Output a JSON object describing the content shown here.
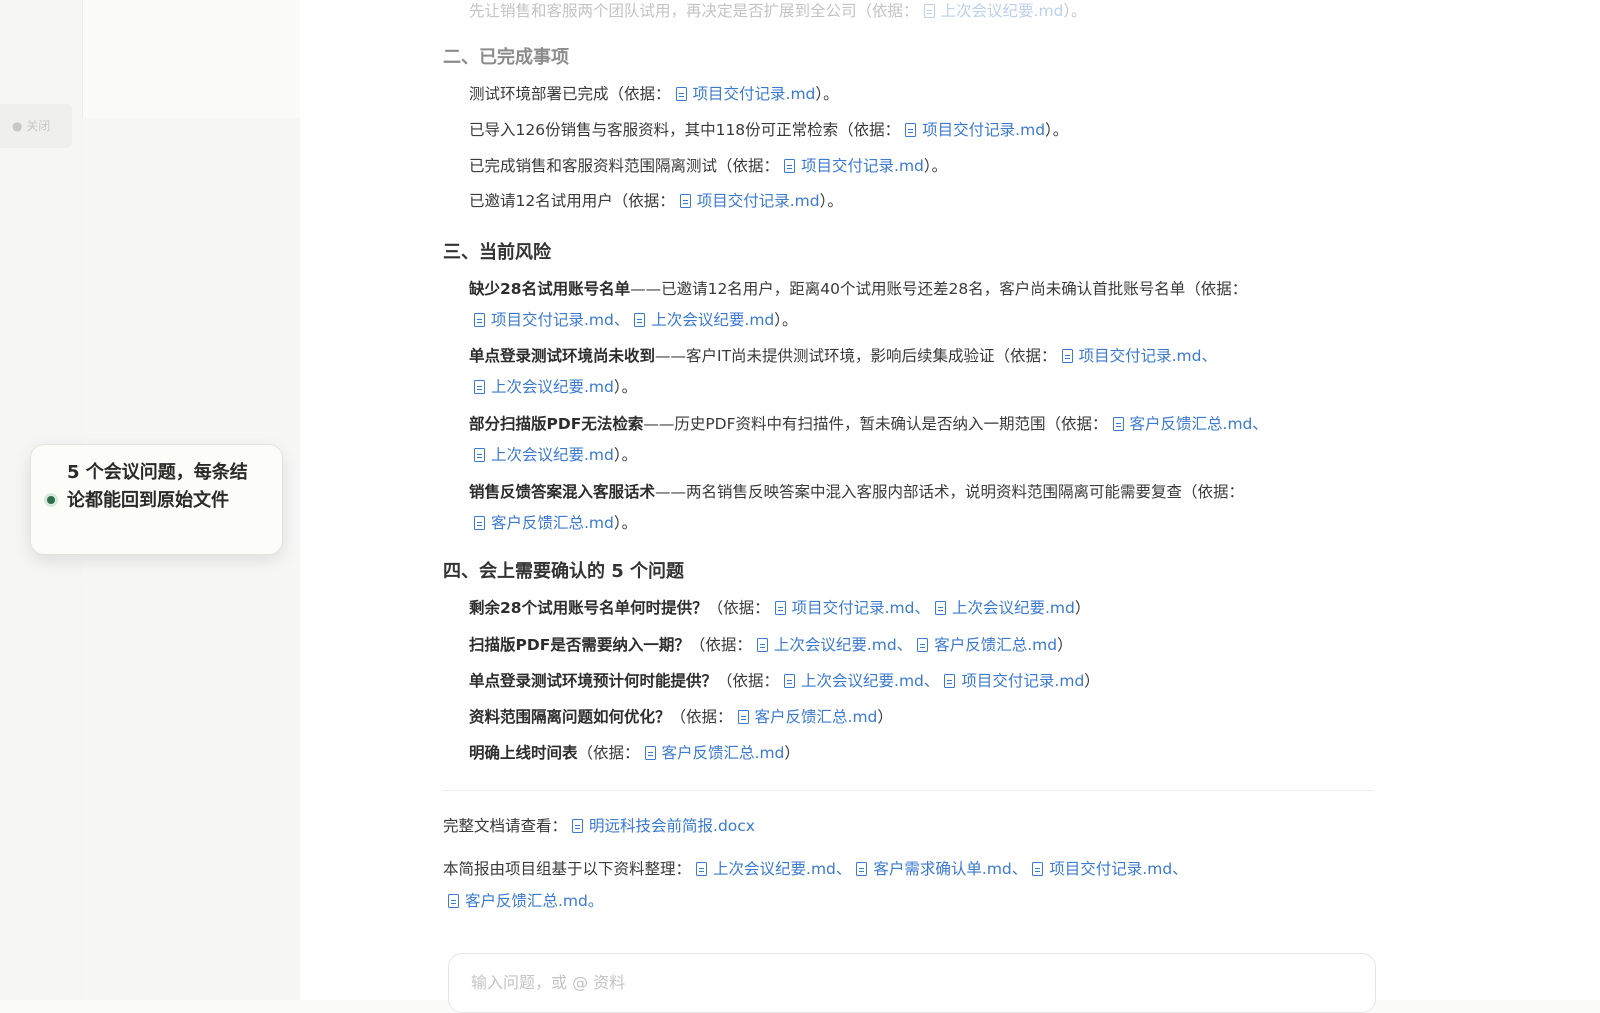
{
  "sidebar": {
    "ghost_label": "● 关闭"
  },
  "callout": {
    "text": "5 个会议问题，每条结论都能回到原始文件"
  },
  "brief": {
    "top_line": {
      "text": "先让销售和客服两个团队试用，再决定是否扩展到全公司（依据：",
      "ref": "上次会议纪要.md",
      "tail": "）。"
    },
    "sec2": {
      "title": "二、已完成事项",
      "items": [
        {
          "text": "测试环境部署已完成（依据：",
          "ref": "项目交付记录.md",
          "tail": "）。"
        },
        {
          "text": "已导入126份销售与客服资料，其中118份可正常检索（依据：",
          "ref": "项目交付记录.md",
          "tail": "）。"
        },
        {
          "text": "已完成销售和客服资料范围隔离测试（依据：",
          "ref": "项目交付记录.md",
          "tail": "）。"
        },
        {
          "text": "已邀请12名试用用户（依据：",
          "ref": "项目交付记录.md",
          "tail": "）。"
        }
      ]
    },
    "sec3": {
      "title": "三、当前风险",
      "items": [
        {
          "bold": "缺少28名试用账号名单",
          "text": "——已邀请12名用户，距离40个试用账号还差28名，客户尚未确认首批账号名单（依据：",
          "ref1": "项目交付记录.md",
          "sep": "、",
          "ref2": "上次会议纪要.md",
          "tail": "）。"
        },
        {
          "bold": "单点登录测试环境尚未收到",
          "text": "——客户IT尚未提供测试环境，影响后续集成验证（依据：",
          "ref1": "项目交付记录.md",
          "sep": "、",
          "ref2": "上次会议纪要.md",
          "tail": "）。"
        },
        {
          "bold": "部分扫描版PDF无法检索",
          "text": "——历史PDF资料中有扫描件，暂未确认是否纳入一期范围（依据：",
          "ref1": "客户反馈汇总.md",
          "sep": "、",
          "ref2": "上次会议纪要.md",
          "tail": "）。"
        },
        {
          "bold": "销售反馈答案混入客服话术",
          "text": "——两名销售反映答案中混入客服内部话术，说明资料范围隔离可能需要复查（依据：",
          "ref1": "客户反馈汇总.md",
          "tail": "）。"
        }
      ]
    },
    "sec4": {
      "title": "四、会上需要确认的 5 个问题",
      "items": [
        {
          "bold": "剩余28个试用账号名单何时提供？",
          "text": "（依据：",
          "refs": [
            "项目交付记录.md",
            "上次会议纪要.md"
          ],
          "tail": "）"
        },
        {
          "bold": "扫描版PDF是否需要纳入一期？",
          "text": "（依据：",
          "refs": [
            "上次会议纪要.md",
            "客户反馈汇总.md"
          ],
          "tail": "）"
        },
        {
          "bold": "单点登录测试环境预计何时能提供？",
          "text": "（依据：",
          "refs": [
            "上次会议纪要.md",
            "项目交付记录.md"
          ],
          "tail": "）"
        },
        {
          "bold": "资料范围隔离问题如何优化？",
          "text": "（依据：",
          "refs": [
            "客户反馈汇总.md"
          ],
          "tail": "）"
        },
        {
          "bold": "明确上线时间表",
          "text": "（依据：",
          "refs": [
            "客户反馈汇总.md"
          ],
          "tail": "）"
        }
      ]
    },
    "footer": {
      "full_doc_label": "完整文档请查看：",
      "full_doc_ref": "明远科技会前简报.docx",
      "sources_label": "本简报由项目组基于以下资料整理：",
      "sources": [
        "上次会议纪要.md",
        "客户需求确认单.md",
        "项目交付记录.md",
        "客户反馈汇总.md"
      ],
      "sep": "、",
      "end": "。"
    }
  },
  "composer": {
    "placeholder": "输入问题，或 @ 资料"
  },
  "colors": {
    "link": "#3b7ad1",
    "accent_dot": "#2f6d4b",
    "heading": "#333333"
  },
  "icons": {
    "file_ref": "document-icon",
    "status": "green-dot-icon"
  }
}
